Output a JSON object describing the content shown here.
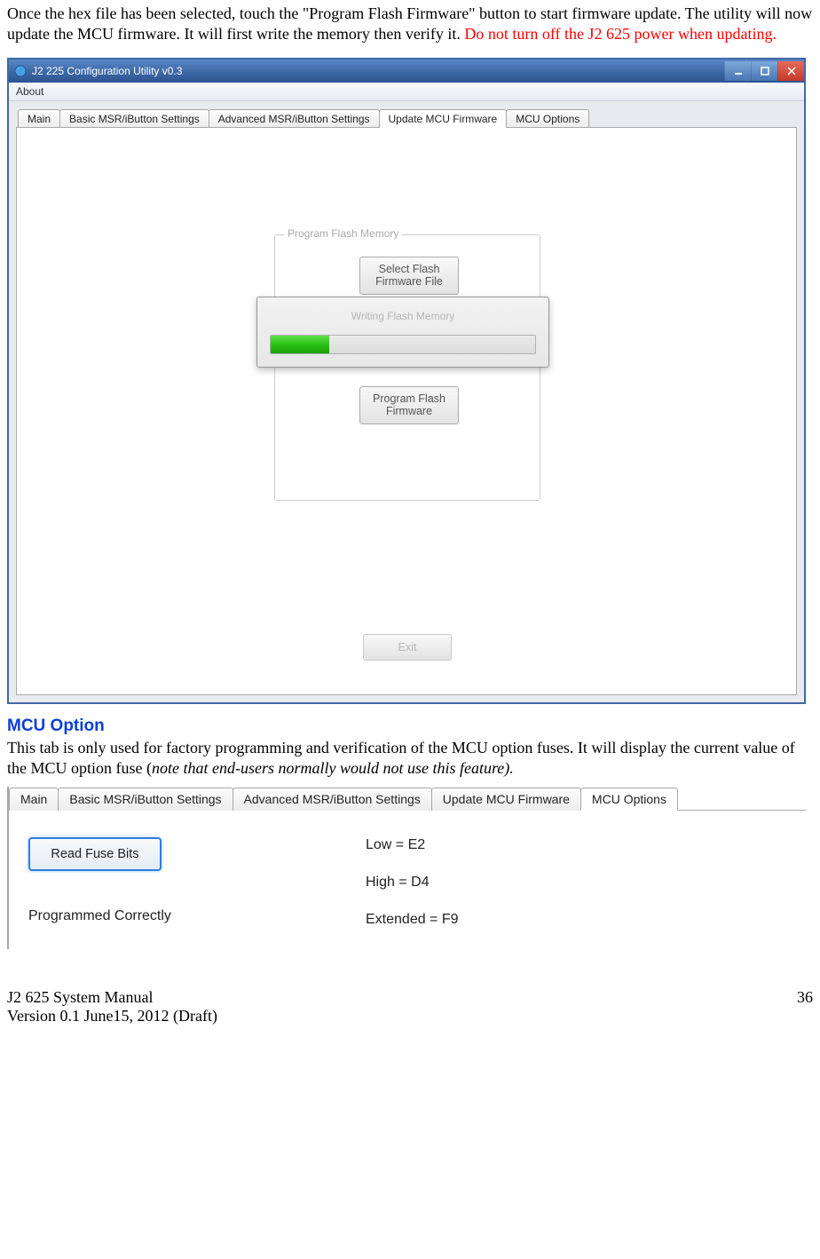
{
  "intro": {
    "p1_a": "Once the hex file has been selected, touch the \"Program Flash Firmware\" button to start firmware update. The utility will now update the MCU firmware. It will first write the memory then verify it. ",
    "p1_warn": "Do not turn off the J2 625 power when updating."
  },
  "window": {
    "title": "J2 225 Configuration Utility  v0.3",
    "menu_about": "About",
    "tabs": {
      "main": "Main",
      "basic": "Basic MSR/iButton Settings",
      "advanced": "Advanced MSR/iButton Settings",
      "update": "Update MCU Firmware",
      "options": "MCU Options"
    },
    "groupbox_legend": "Program Flash Memory",
    "btn_select": "Select Flash Firmware File",
    "btn_program": "Program Flash Firmware",
    "dialog_title": "Writing Flash Memory",
    "progress_percent": 22,
    "btn_exit": "Exit"
  },
  "mcu_option": {
    "heading": "MCU Option",
    "p1": "This tab is only used for factory programming and verification of the MCU option fuses. It will display the current value of the MCU option fuse (",
    "p1_italic": "note that end-users normally would not use this feature).",
    "tabs": {
      "main": "Main",
      "basic": "Basic MSR/iButton Settings",
      "advanced": "Advanced MSR/iButton Settings",
      "update": "Update MCU Firmware",
      "options": "MCU Options"
    },
    "btn_read": "Read Fuse Bits",
    "status": "Programmed Correctly",
    "low_label": "Low = E2",
    "high_label": "High = D4",
    "ext_label": "Extended = F9"
  },
  "footer": {
    "left1": "J2 625 System Manual",
    "left2": "Version 0.1 June15, 2012 (Draft)",
    "page": "36"
  }
}
